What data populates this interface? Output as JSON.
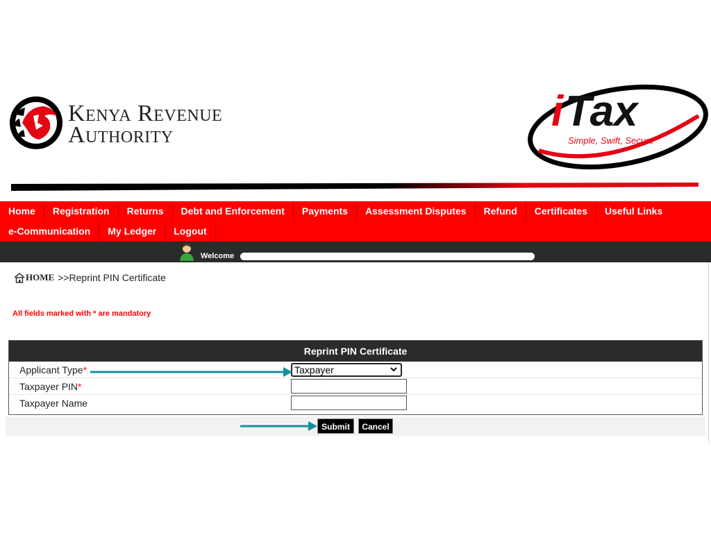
{
  "header": {
    "org_name_line1": "Kenya Revenue",
    "org_name_line2": "Authority",
    "itax_brand": "iTax",
    "itax_tagline": "Simple, Swift, Secure"
  },
  "nav": {
    "row1": [
      "Home",
      "Registration",
      "Returns",
      "Debt and Enforcement",
      "Payments",
      "Assessment Disputes",
      "Refund",
      "Certificates",
      "Useful Links"
    ],
    "row2": [
      "e-Communication",
      "My Ledger",
      "Logout"
    ]
  },
  "welcome": {
    "label": "Welcome"
  },
  "breadcrumb": {
    "home": "HOME",
    "current": ">>Reprint PIN Certificate"
  },
  "mandatory_note": "All fields marked with * are mandatory",
  "form": {
    "title": "Reprint PIN Certificate",
    "applicant_type_label": "Applicant Type",
    "applicant_type_value": "Taxpayer",
    "taxpayer_pin_label": "Taxpayer PIN",
    "taxpayer_name_label": "Taxpayer Name",
    "required_mark": "*",
    "submit_label": "Submit",
    "cancel_label": "Cancel"
  },
  "colors": {
    "nav_red": "#ff0000",
    "dark_bar": "#2b2b2b",
    "annotation_teal": "#14909a"
  }
}
